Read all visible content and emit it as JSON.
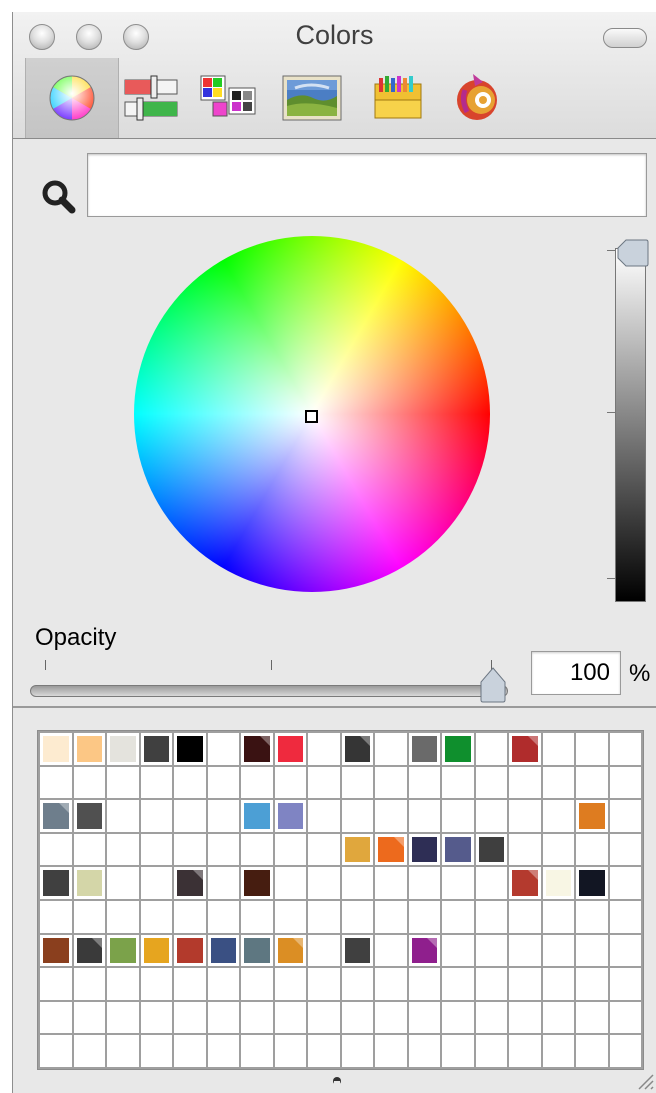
{
  "window": {
    "title": "Colors"
  },
  "toolbar": {
    "buttons": [
      {
        "name": "color-wheel-tab",
        "icon": "color-wheel-icon"
      },
      {
        "name": "color-sliders-tab",
        "icon": "sliders-icon"
      },
      {
        "name": "color-palettes-tab",
        "icon": "palettes-icon"
      },
      {
        "name": "image-palettes-tab",
        "icon": "image-palette-icon"
      },
      {
        "name": "crayons-tab",
        "icon": "crayons-icon"
      },
      {
        "name": "extra-picker-tab",
        "icon": "color-picker-plugin-icon"
      }
    ],
    "selected": "color-wheel-tab"
  },
  "search": {
    "value": "",
    "placeholder": ""
  },
  "wheel": {
    "selected_color": "#ffffff",
    "brightness": 1.0
  },
  "opacity": {
    "label": "Opacity",
    "value": "100",
    "unit": "%"
  },
  "swatches": {
    "columns": 18,
    "rows": [
      [
        "#fdebd0",
        "#fcc785",
        "#e4e3dd",
        "#404040",
        "#000000",
        null,
        "#3a1212",
        "#ef2a3e",
        null,
        "#353535",
        null,
        "#6a6a6a",
        "#0f8f2d",
        null,
        "#b02c2c",
        null,
        null,
        null
      ],
      [
        null,
        null,
        null,
        null,
        null,
        null,
        null,
        null,
        null,
        null,
        null,
        null,
        null,
        null,
        null,
        null,
        null,
        null
      ],
      [
        "#6e7e8c",
        "#505050",
        null,
        null,
        null,
        null,
        "#4c9fd5",
        "#7f84c3",
        null,
        null,
        null,
        null,
        null,
        null,
        null,
        null,
        "#de7c20",
        null
      ],
      [
        null,
        null,
        null,
        null,
        null,
        null,
        null,
        null,
        null,
        "#e0a73d",
        "#ed6a1d",
        "#2e2e55",
        "#555b8c",
        "#3f3f3f",
        null,
        null,
        null,
        null
      ],
      [
        "#404040",
        "#d4d6a8",
        null,
        null,
        "#3b3135",
        null,
        "#461d10",
        null,
        null,
        null,
        null,
        null,
        null,
        null,
        "#b43a2e",
        "#f8f6e4",
        "#121623",
        null
      ],
      [
        null,
        null,
        null,
        null,
        null,
        null,
        null,
        null,
        null,
        null,
        null,
        null,
        null,
        null,
        null,
        null,
        null,
        null
      ],
      [
        "#8a3f1e",
        "#3a3a3a",
        "#7ba24a",
        "#e6a51f",
        "#b33a2c",
        "#3a5083",
        "#5e7781",
        "#db8e24",
        null,
        "#404040",
        null,
        "#8f1f8d",
        null,
        null,
        null,
        null,
        null,
        null
      ],
      [
        null,
        null,
        null,
        null,
        null,
        null,
        null,
        null,
        null,
        null,
        null,
        null,
        null,
        null,
        null,
        null,
        null,
        null
      ],
      [
        null,
        null,
        null,
        null,
        null,
        null,
        null,
        null,
        null,
        null,
        null,
        null,
        null,
        null,
        null,
        null,
        null,
        null
      ],
      [
        null,
        null,
        null,
        null,
        null,
        null,
        null,
        null,
        null,
        null,
        null,
        null,
        null,
        null,
        null,
        null,
        null,
        null
      ]
    ],
    "folded": [
      "0-6",
      "0-9",
      "0-14",
      "2-0",
      "4-4",
      "4-14",
      "6-1",
      "6-7",
      "6-11",
      "3-10"
    ]
  }
}
